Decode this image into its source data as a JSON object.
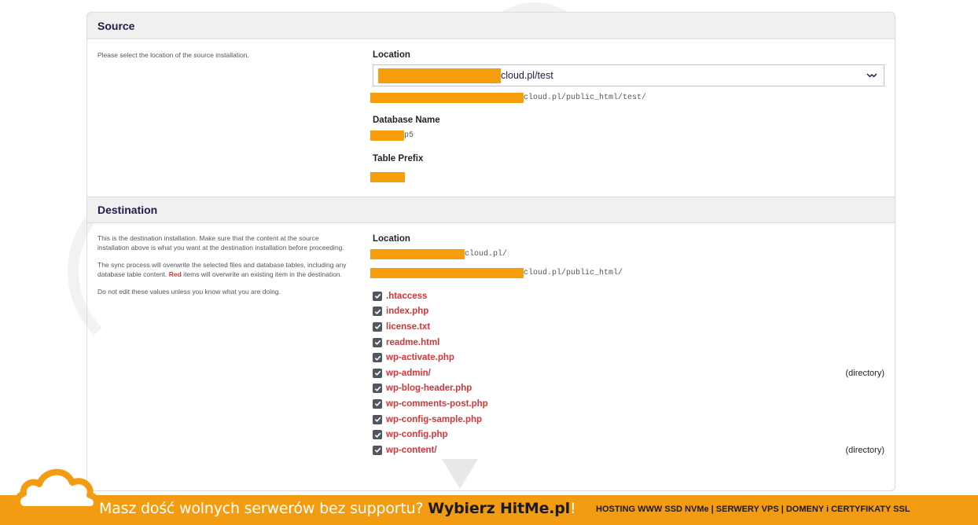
{
  "source": {
    "heading": "Source",
    "description": "Please select the location of the source installation.",
    "location_label": "Location",
    "location_select_value": "cloud.pl/test",
    "location_path": "cloud.pl/public_html/test/",
    "db_label": "Database Name",
    "db_value": "p5",
    "prefix_label": "Table Prefix"
  },
  "destination": {
    "heading": "Destination",
    "desc_1": "This is the destination installation. Make sure that the content at the source installation above is what you want at the destination installation before proceeding.",
    "desc_2a": "The sync process will overwrite the selected files and database tables, including any database table content. ",
    "desc_2_red": "Red",
    "desc_2b": " items will overwrite an existing item in the destination.",
    "desc_3": "Do not edit these values unless you know what you are doing.",
    "location_label": "Location",
    "location_url": "cloud.pl/",
    "location_path": "cloud.pl/public_html/",
    "files": [
      {
        "name": ".htaccess",
        "type": ""
      },
      {
        "name": "index.php",
        "type": ""
      },
      {
        "name": "license.txt",
        "type": ""
      },
      {
        "name": "readme.html",
        "type": ""
      },
      {
        "name": "wp-activate.php",
        "type": ""
      },
      {
        "name": "wp-admin/",
        "type": "(directory)"
      },
      {
        "name": "wp-blog-header.php",
        "type": ""
      },
      {
        "name": "wp-comments-post.php",
        "type": ""
      },
      {
        "name": "wp-config-sample.php",
        "type": ""
      },
      {
        "name": "wp-config.php",
        "type": ""
      },
      {
        "name": "wp-content/",
        "type": "(directory)"
      }
    ]
  },
  "banner": {
    "text_before": "Masz dość wolnych serwerów bez supportu? ",
    "brand": "Wybierz HitMe.pl",
    "text_after": "!",
    "right_text": "HOSTING WWW SSD NVMe | SERWERY VPS | DOMENY i CERTYFIKATY SSL"
  },
  "colors": {
    "redaction": "#f79e0c",
    "banner": "#f39c12",
    "accent_red": "#d63638",
    "heading": "#1e1d4c"
  }
}
